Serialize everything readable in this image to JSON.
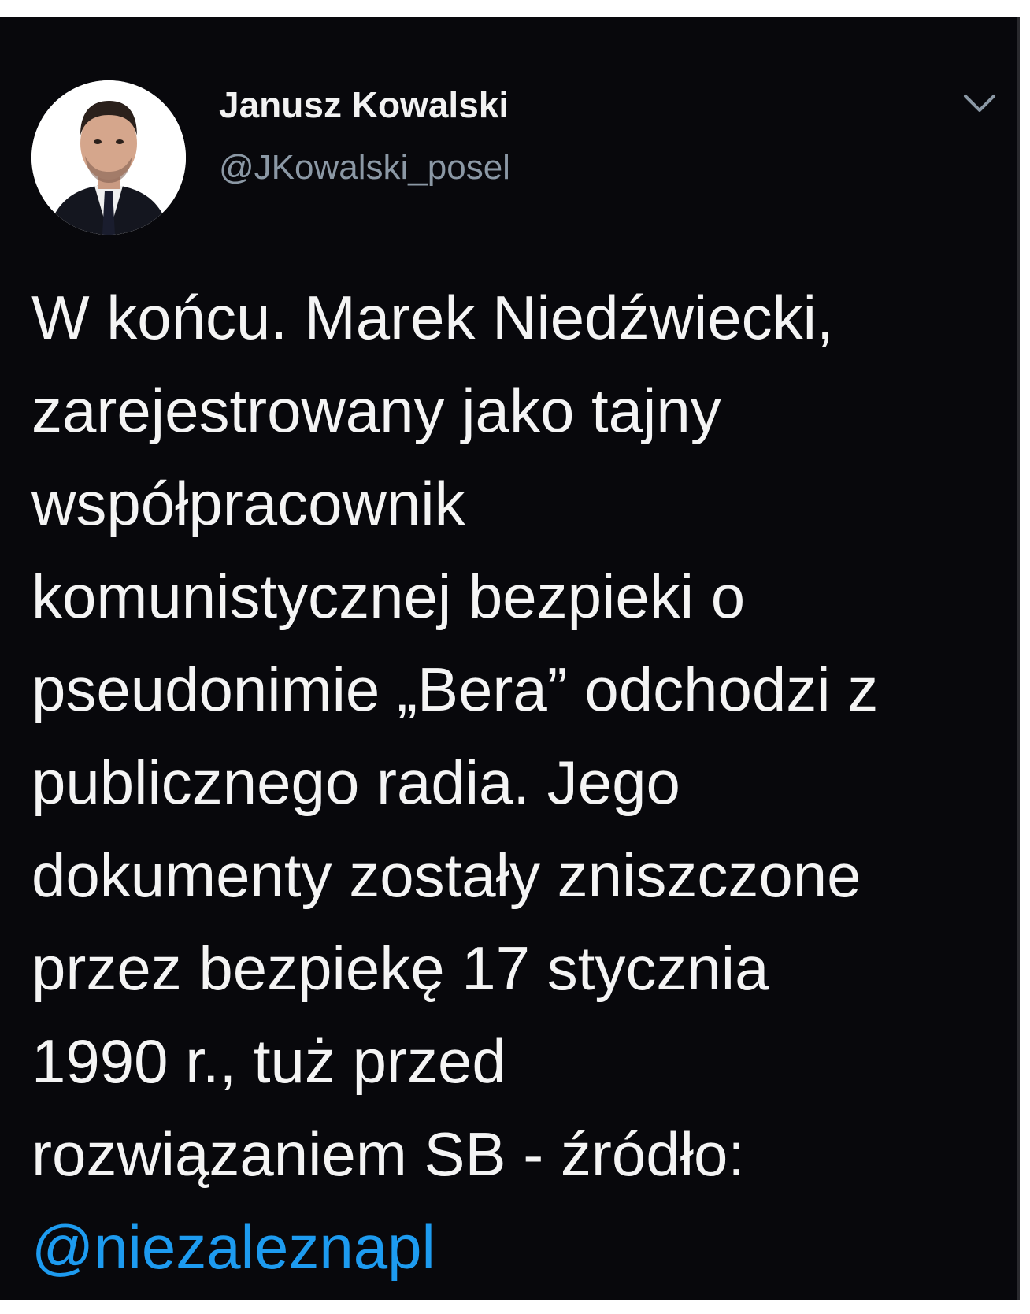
{
  "tweet": {
    "author": {
      "display_name": "Janusz Kowalski",
      "handle": "@JKowalski_posel"
    },
    "text_lines": [
      "W końcu. Marek Niedźwiecki,",
      "zarejestrowany jako tajny",
      "współpracownik",
      "komunistycznej bezpieki o",
      "pseudonimie „Bera” odchodzi z",
      "publicznego radia. Jego",
      "dokumenty zostały zniszczone",
      "przez bezpiekę 17 stycznia",
      "1990 r., tuż przed",
      "rozwiązaniem SB - źródło:"
    ],
    "mention": "@niezaleznapl",
    "menu_icon": "chevron-down-icon"
  },
  "colors": {
    "background": "#08080c",
    "text": "#f4f4f4",
    "secondary_text": "#8b98a5",
    "link": "#1d9bf0"
  }
}
